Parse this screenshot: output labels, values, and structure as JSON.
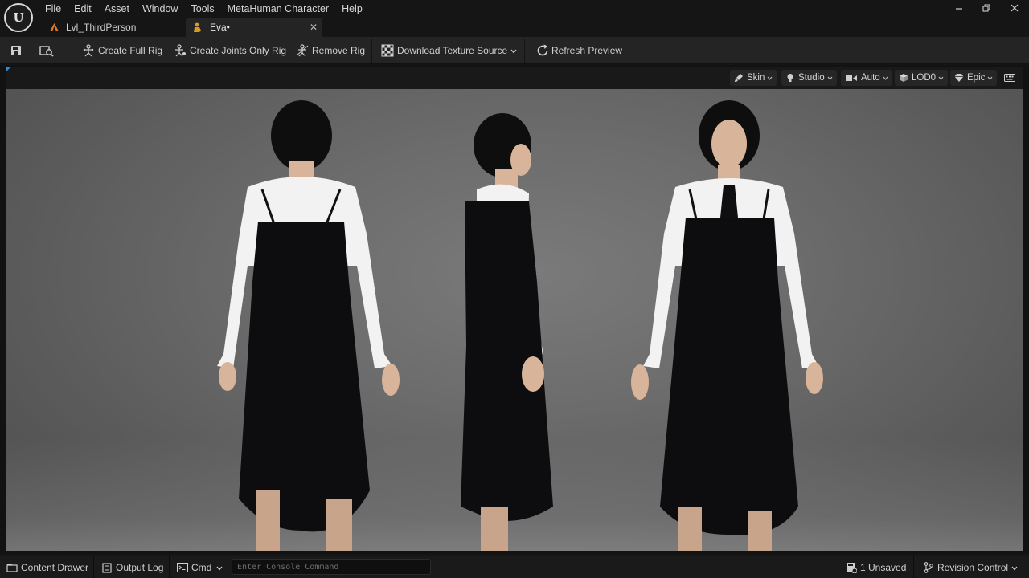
{
  "app": {
    "logo_letter": "U",
    "menu": [
      "File",
      "Edit",
      "Asset",
      "Window",
      "Tools",
      "MetaHuman Character",
      "Help"
    ],
    "window_controls": {
      "minimize": "🗕",
      "restore": "🗗",
      "close": "✕"
    }
  },
  "tabs": [
    {
      "label": "Lvl_ThirdPerson",
      "icon": "level-icon",
      "active": false
    },
    {
      "label": "Eva•",
      "icon": "metahuman-icon",
      "active": true,
      "close": "✕"
    }
  ],
  "toolbar": {
    "save_icon": "save-icon",
    "browse_icon": "browse-to-asset-icon",
    "create_full_rig": "Create Full Rig",
    "create_joints_only_rig": "Create Joints Only Rig",
    "remove_rig": "Remove Rig",
    "download_texture_source": "Download Texture Source",
    "refresh_preview": "Refresh Preview"
  },
  "viewport": {
    "skin": "Skin",
    "lighting": "Studio",
    "camera": "Auto",
    "lod": "LOD0",
    "quality": "Epic",
    "keyboard_icon": "keyboard-icon"
  },
  "statusbar": {
    "content_drawer": "Content Drawer",
    "output_log": "Output Log",
    "cmd": "Cmd",
    "console_placeholder": "Enter Console Command",
    "unsaved": "1 Unsaved",
    "revision_control": "Revision Control"
  },
  "colors": {
    "accent": "#2e8cd6",
    "panel": "#242424",
    "background": "#151515",
    "level_icon": "#e07b24",
    "metahuman_icon": "#d49a2a"
  }
}
